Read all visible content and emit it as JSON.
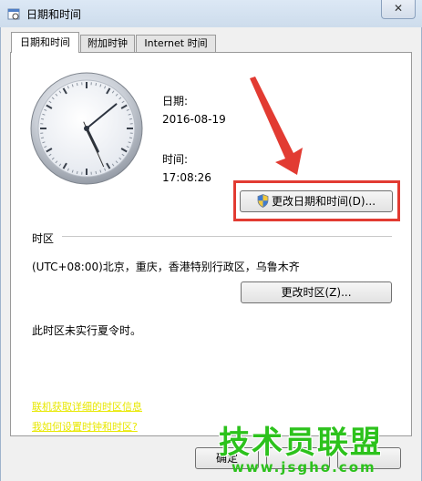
{
  "window": {
    "title": "日期和时间",
    "close_glyph": "✕"
  },
  "tabs": [
    {
      "label": "日期和时间",
      "active": true
    },
    {
      "label": "附加时钟",
      "active": false
    },
    {
      "label": "Internet 时间",
      "active": false
    }
  ],
  "clock": {
    "hour": 17,
    "minute": 8,
    "second": 26
  },
  "date": {
    "label": "日期:",
    "value": "2016-08-19"
  },
  "time": {
    "label": "时间:",
    "value": "17:08:26"
  },
  "change_datetime_button": "更改日期和时间(D)...",
  "timezone": {
    "section_label": "时区",
    "value": "(UTC+08:00)北京，重庆，香港特别行政区，乌鲁木齐",
    "change_button": "更改时区(Z)...",
    "dst_note": "此时区未实行夏令时。"
  },
  "links": [
    "联机获取详细的时区信息",
    "我如何设置时钟和时区?"
  ],
  "footer": {
    "ok_button": "确定"
  },
  "watermark": {
    "main": "技术员联盟",
    "url": "www.jsgho.com"
  },
  "colors": {
    "highlight": "#e23b32",
    "arrow": "#e23b32",
    "watermark": "#2cc21c",
    "link": "#e8e800"
  }
}
